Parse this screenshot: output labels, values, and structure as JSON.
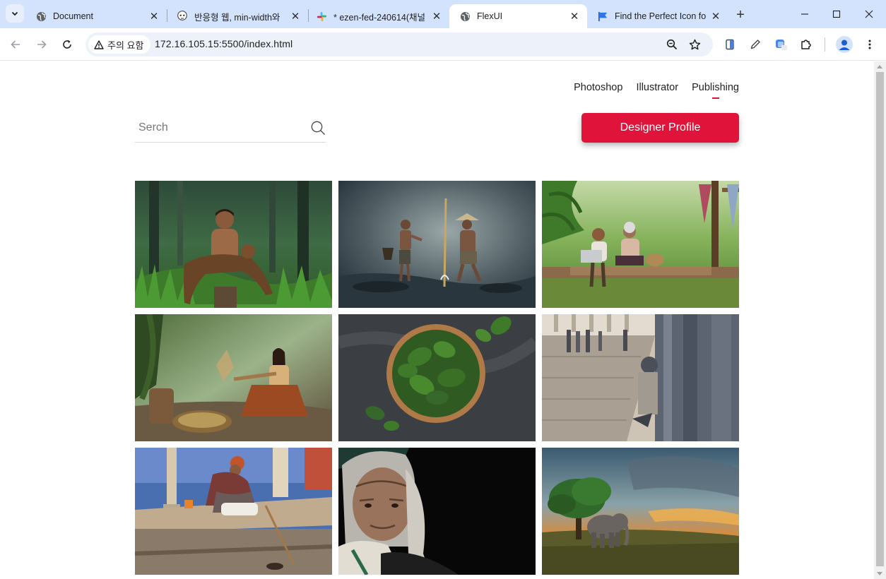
{
  "browser": {
    "tabs": [
      {
        "title": "Document",
        "favicon": "globe-icon",
        "active": false
      },
      {
        "title": "반응형 웹, min-width와",
        "favicon": "skull-icon",
        "active": false
      },
      {
        "title": "* ezen-fed-240614(채널",
        "favicon": "slack-icon",
        "active": false
      },
      {
        "title": "FlexUI",
        "favicon": "globe-icon",
        "active": true
      },
      {
        "title": "Find the Perfect Icon fo",
        "favicon": "flag-icon",
        "active": false
      }
    ],
    "security_label": "주의 요함",
    "url": "172.16.105.15:5500/index.html"
  },
  "page": {
    "nav": [
      {
        "label": "Photoshop",
        "active": false
      },
      {
        "label": "Illustrator",
        "active": false
      },
      {
        "label": "Publishing",
        "active": true
      }
    ],
    "search_placeholder": "Serch",
    "cta_label": "Designer Profile",
    "accent_color": "#e0143b",
    "gallery": [
      {
        "subject": "boy holding a goat in a green forest"
      },
      {
        "subject": "boy and man fishing in misty water"
      },
      {
        "subject": "boy with laptop and grandmother on wooden platform"
      },
      {
        "subject": "woman winnowing grain in a basket"
      },
      {
        "subject": "bowl of spinach leaves on dark table"
      },
      {
        "subject": "street scene with seated man, sepia tone"
      },
      {
        "subject": "elderly man in shawl sitting on blue steps"
      },
      {
        "subject": "portrait of elderly woman on black background"
      },
      {
        "subject": "elephant under a tree at sunset"
      }
    ]
  }
}
